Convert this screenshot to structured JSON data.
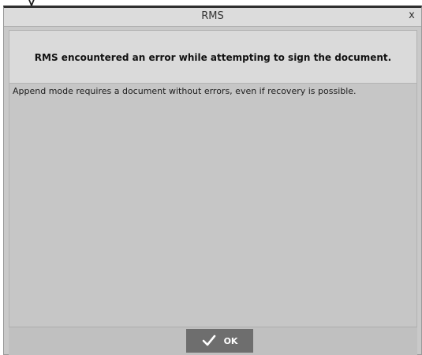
{
  "background": {
    "partial_text": "y"
  },
  "dialog": {
    "title": "RMS",
    "close_glyph": "x",
    "header_message": "RMS encountered an error while attempting to sign the document.",
    "detail_message": "Append mode requires a document without errors, even if recovery is possible.",
    "ok_label": "OK",
    "ok_icon": "checkmark-icon",
    "colors": {
      "dialog_bg": "#c9c9c9",
      "header_bg": "#dadada",
      "button_bg": "#6e6e6e",
      "button_text": "#ffffff"
    }
  }
}
